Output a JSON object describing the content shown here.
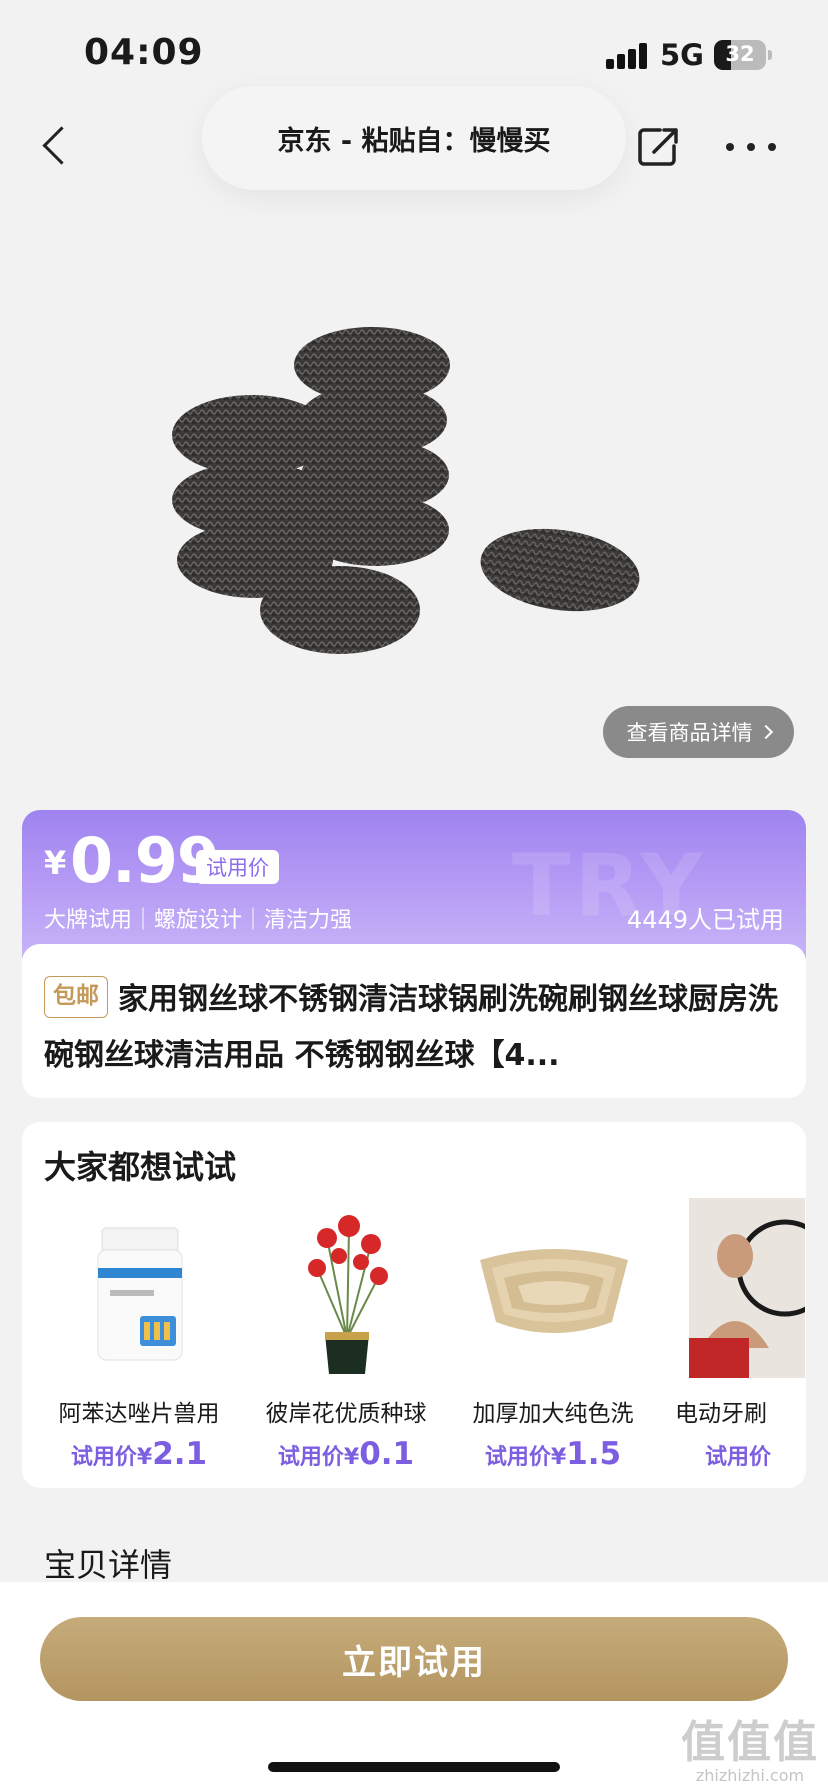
{
  "status_bar": {
    "time": "04:09",
    "network": "5G",
    "battery": "32",
    "battery_level": 0.32
  },
  "nav": {
    "title": "京东 - 粘贴自：慢慢买"
  },
  "hero": {
    "detail_link": "查看商品详情"
  },
  "price_card": {
    "watermark": "TRY",
    "currency": "¥",
    "price": "0.99",
    "price_tag": "试用价",
    "features": "大牌试用｜螺旋设计｜清洁力强",
    "trial_count": "4449人已试用"
  },
  "product": {
    "badge": "包邮",
    "title": "家用钢丝球不锈钢清洁球锅刷洗碗刷钢丝球厨房洗碗钢丝球清洁用品 不锈钢钢丝球【4..."
  },
  "recommendations": {
    "title": "大家都想试试",
    "items": [
      {
        "name": "阿苯达唑片兽用",
        "price_label": "试用价¥",
        "price": "2.1",
        "icon": "medicine-bottle"
      },
      {
        "name": "彼岸花优质种球",
        "price_label": "试用价¥",
        "price": "0.1",
        "icon": "flower-pot"
      },
      {
        "name": "加厚加大纯色洗",
        "price_label": "试用价¥",
        "price": "1.5",
        "icon": "washbasin"
      },
      {
        "name": "电动牙刷",
        "price_label": "试用价",
        "price": "",
        "icon": "bathroom-mirror"
      }
    ]
  },
  "details": {
    "title": "宝贝详情"
  },
  "footer": {
    "try_button": "立即试用",
    "site_mark": "值值值",
    "site_domain": "zhizhizhi.com"
  },
  "colors": {
    "accent_purple": "#9f83f0",
    "gold": "#b39560",
    "price_text": "#7c5ee0"
  }
}
